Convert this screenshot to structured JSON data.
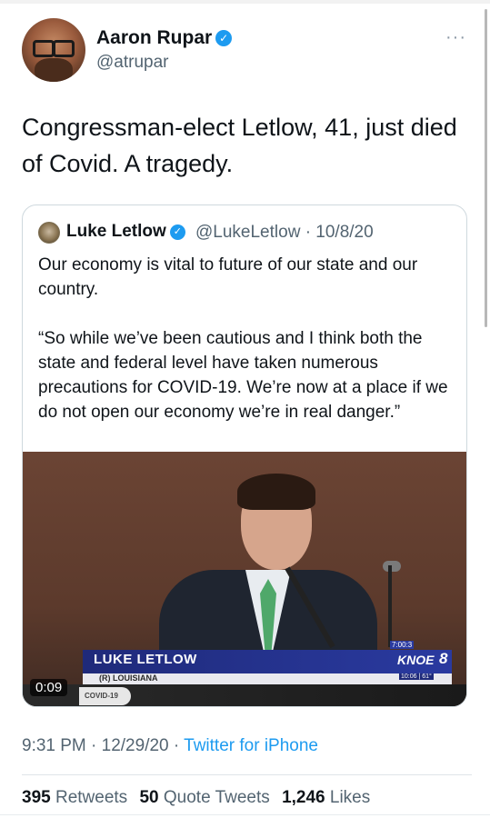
{
  "tweet": {
    "author_name": "Aaron Rupar",
    "author_handle": "@atrupar",
    "more_label": "···",
    "text_line1": "Congressman-elect Letlow, 41, just died",
    "text_line2": "of Covid. A tragedy.",
    "timestamp": "9:31 PM · 12/29/20 · ",
    "source": "Twitter for iPhone"
  },
  "quoted": {
    "author_name": "Luke Letlow",
    "author_handle_date": "@LukeLetlow · 10/8/20",
    "para1": "Our economy is vital to future of our state and our country.",
    "para2": "“So while we’ve been cautious and I think both the state and federal level have taken numerous precautions for COVID-19. We’re now at a place if we do not open our economy we’re in real danger.”"
  },
  "video": {
    "duration": "0:09",
    "lower_third_name": "LUKE LETLOW",
    "lower_third_sub": "(R) LOUISIANA",
    "station_logo": "KNOE",
    "station_num": "8",
    "station_info": "10:06 | 61°",
    "ticker_label": "COVID-19",
    "time_chip": "7:00:3"
  },
  "stats": {
    "retweets_count": "395",
    "retweets_label": "Retweets",
    "quotes_count": "50",
    "quotes_label": "Quote Tweets",
    "likes_count": "1,246",
    "likes_label": "Likes"
  },
  "colors": {
    "accent": "#1d9bf0",
    "secondary_text": "#536471",
    "primary_text": "#0f1419"
  }
}
